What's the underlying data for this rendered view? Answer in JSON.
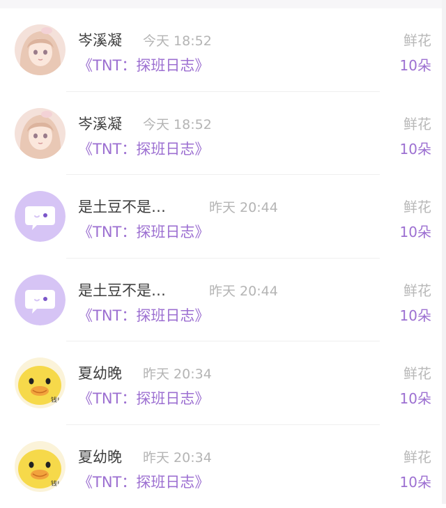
{
  "messages": [
    {
      "name": "岑溪凝",
      "time": "今天 18:52",
      "title": "《TNT：探班日志》",
      "gift": "鲜花",
      "count": "10朵",
      "avatar": "anime-girl-icon"
    },
    {
      "name": "岑溪凝",
      "time": "今天 18:52",
      "title": "《TNT：探班日志》",
      "gift": "鲜花",
      "count": "10朵",
      "avatar": "anime-girl-icon"
    },
    {
      "name": "是土豆不是…",
      "time": "昨天 20:44",
      "title": "《TNT：探班日志》",
      "gift": "鲜花",
      "count": "10朵",
      "avatar": "chat-bubble-icon"
    },
    {
      "name": "是土豆不是…",
      "time": "昨天 20:44",
      "title": "《TNT：探班日志》",
      "gift": "鲜花",
      "count": "10朵",
      "avatar": "chat-bubble-icon"
    },
    {
      "name": "夏幼晚",
      "time": "昨天 20:34",
      "title": "《TNT：探班日志》",
      "gift": "鲜花",
      "count": "10朵",
      "avatar": "duck-meme-icon",
      "avatar_text": "钱!"
    },
    {
      "name": "夏幼晚",
      "time": "昨天 20:34",
      "title": "《TNT：探班日志》",
      "gift": "鲜花",
      "count": "10朵",
      "avatar": "duck-meme-icon",
      "avatar_text": "钱!"
    }
  ],
  "colors": {
    "accent": "#9c6fd1",
    "name": "#3d3d3d",
    "muted": "#b4b4b4",
    "avatar_purple": "#d6c4f5"
  }
}
